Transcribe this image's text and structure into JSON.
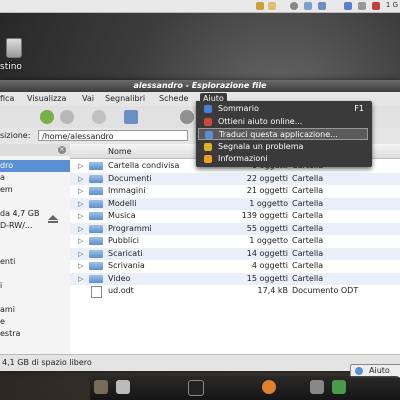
{
  "desktop": {
    "trash_label": "stino",
    "tray_clock": "1 G"
  },
  "window": {
    "title": "alessandro - Esplorazione file"
  },
  "menubar": {
    "items": [
      "fica",
      "Visualizza",
      "Vai",
      "Segnalibri",
      "Schede",
      "Aiuto"
    ]
  },
  "locbar": {
    "label": "sizione:",
    "value": "/home/alessandro"
  },
  "sidebar": {
    "items": [
      "dro",
      "a",
      "em",
      "",
      "da 4,7 GB",
      "D-RW/...",
      "",
      "enti",
      "",
      "i",
      "",
      "ami",
      "e",
      "estra"
    ]
  },
  "filelist": {
    "column_name": "Nome",
    "rows": [
      {
        "name": "Cartella condivisa",
        "size": "6 oggetti",
        "type": "Cartella"
      },
      {
        "name": "Documenti",
        "size": "22 oggetti",
        "type": "Cartella"
      },
      {
        "name": "Immagini",
        "size": "21 oggetti",
        "type": "Cartella"
      },
      {
        "name": "Modelli",
        "size": "1 oggetto",
        "type": "Cartella"
      },
      {
        "name": "Musica",
        "size": "139 oggetti",
        "type": "Cartella"
      },
      {
        "name": "Programmi",
        "size": "55 oggetti",
        "type": "Cartella"
      },
      {
        "name": "Pubblici",
        "size": "1 oggetto",
        "type": "Cartella"
      },
      {
        "name": "Scaricati",
        "size": "14 oggetti",
        "type": "Cartella"
      },
      {
        "name": "Scrivania",
        "size": "4 oggetti",
        "type": "Cartella"
      },
      {
        "name": "Video",
        "size": "15 oggetti",
        "type": "Cartella"
      },
      {
        "name": "ud.odt",
        "size": "17,4 kB",
        "type": "Documento ODT"
      }
    ]
  },
  "status": {
    "text": "4,1 GB di spazio libero"
  },
  "help_menu": {
    "items": [
      {
        "label": "Sommario",
        "shortcut": "F1",
        "icon": "help-icon",
        "color": "#4a7fd4"
      },
      {
        "label": "Ottieni aiuto online...",
        "shortcut": "",
        "icon": "online-help-icon",
        "color": "#d04a3a"
      },
      {
        "label": "Traduci questa applicazione...",
        "shortcut": "",
        "icon": "translate-icon",
        "color": "#5b8fd4"
      },
      {
        "label": "Segnala un problema",
        "shortcut": "",
        "icon": "bug-icon",
        "color": "#e0b020"
      },
      {
        "label": "Informazioni",
        "shortcut": "",
        "icon": "about-icon",
        "color": "#f0a020"
      }
    ]
  },
  "dock": {
    "help_button": "Aiuto"
  },
  "colors": {
    "selection": "#5b8fd4",
    "menu_bg": "#3a3a3a"
  }
}
